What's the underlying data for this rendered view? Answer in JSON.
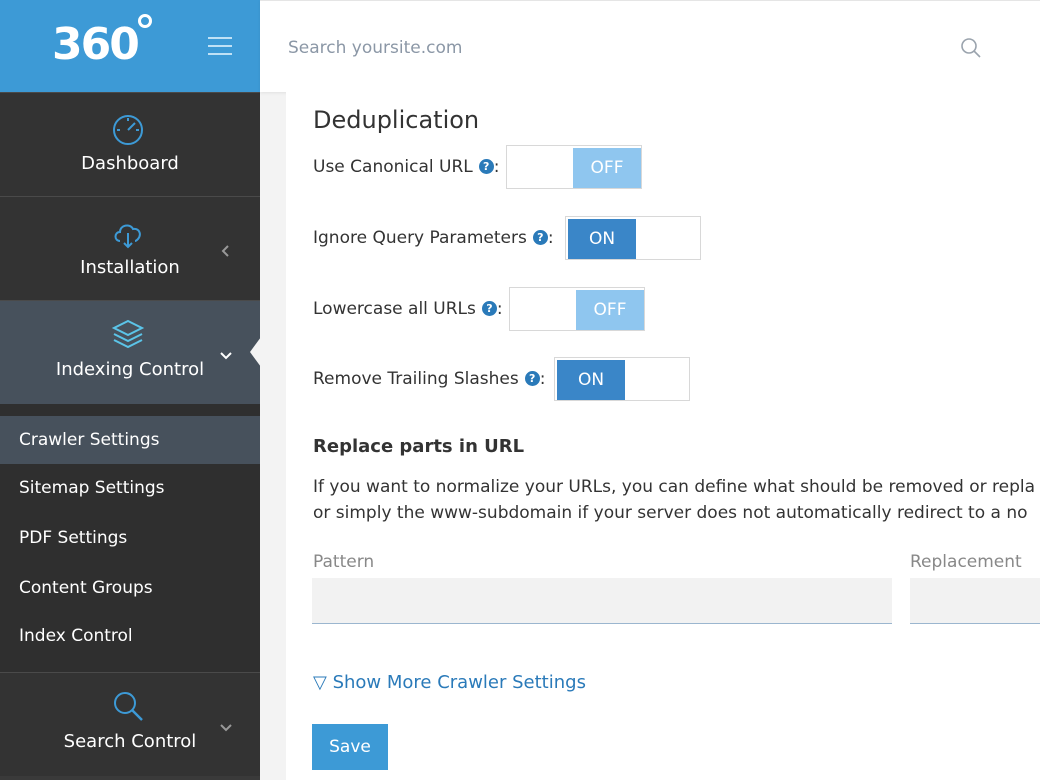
{
  "logo": {
    "text": "360"
  },
  "header": {
    "search_placeholder": "Search yoursite.com"
  },
  "sidebar": {
    "nav": [
      {
        "label": "Dashboard",
        "icon": "speedometer-icon"
      },
      {
        "label": "Installation",
        "icon": "cloud-download-icon"
      },
      {
        "label": "Indexing Control",
        "icon": "layers-icon"
      },
      {
        "label": "Search Control",
        "icon": "search-icon"
      }
    ],
    "subitems": [
      {
        "label": "Crawler Settings",
        "active": true
      },
      {
        "label": "Sitemap Settings"
      },
      {
        "label": "PDF Settings"
      },
      {
        "label": "Content Groups"
      },
      {
        "label": "Index Control"
      }
    ]
  },
  "main": {
    "title": "Deduplication",
    "options": [
      {
        "label": "Use Canonical URL",
        "state": "OFF"
      },
      {
        "label": "Ignore Query Parameters",
        "state": "ON"
      },
      {
        "label": "Lowercase all URLs",
        "state": "OFF"
      },
      {
        "label": "Remove Trailing Slashes",
        "state": "ON"
      }
    ],
    "replace_heading": "Replace parts in URL",
    "replace_desc_1": "If you want to normalize your URLs, you can define what should be removed or repla",
    "replace_desc_2": "or simply the www-subdomain if your server does not automatically redirect to a no",
    "pattern_label": "Pattern",
    "replacement_label": "Replacement",
    "more_link": "▽ Show More Crawler Settings",
    "save_label": "Save"
  },
  "colors": {
    "brand": "#3d9ad6",
    "sidebar_bg": "#333333",
    "sidebar_active": "#47515c",
    "toggle_on": "#3a86c8",
    "toggle_off": "#8fc6ef",
    "link": "#2a7ab9"
  }
}
